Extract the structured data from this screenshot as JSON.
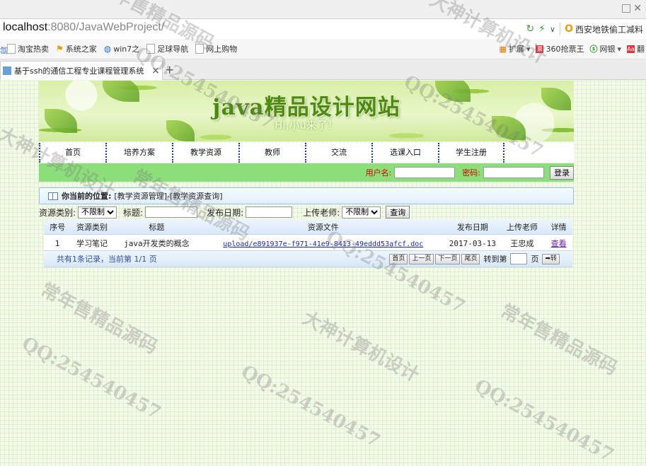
{
  "browser": {
    "url_host": "localhost",
    "url_rest": ":8080/JavaWebProject/",
    "search_hint": "西安地铁偷工减料",
    "bookmarks": [
      "淘宝热卖",
      "系统之家",
      "win7之",
      "足球导航",
      "网上购物"
    ],
    "toolbar_right": [
      "扩展",
      "360抢票王",
      "网银",
      "翻"
    ],
    "tab_title": "基于ssh的通信工程专业课程管理系统"
  },
  "site": {
    "title": "java精品设计网站",
    "subtitle": "Hi,小u来了！",
    "nav": [
      "首页",
      "培养方案",
      "教学资源",
      "教师",
      "交流",
      "选课入口",
      "学生注册"
    ],
    "login": {
      "username_label": "用户名:",
      "password_label": "密码:",
      "button": "登录"
    },
    "position": {
      "label": "你当前的位置:",
      "path": "[教学资源管理]-[教学资源查询]"
    }
  },
  "filters": {
    "type_label": "资源类别:",
    "type_value": "不限制",
    "title_label": "标题:",
    "date_label": "发布日期:",
    "teacher_label": "上传老师:",
    "teacher_value": "不限制",
    "query_button": "查询"
  },
  "table": {
    "headers": [
      "序号",
      "资源类别",
      "标题",
      "资源文件",
      "发布日期",
      "上传老师",
      "详情"
    ],
    "rows": [
      {
        "no": "1",
        "type": "学习笔记",
        "title": "java开发类的概念",
        "file": "upload/e891937e-f971-41e9-8413-49eddd53afcf.doc",
        "date": "2017-03-13",
        "teacher": "王忠成",
        "detail": "查看"
      }
    ]
  },
  "pager": {
    "info": "共有1条记录，当前第 1/1 页",
    "first": "首页",
    "prev": "上一页",
    "next": "下一页",
    "last": "尾页",
    "goto_label": "转到第",
    "page_unit": "页",
    "goto_button": "➡转"
  },
  "watermark": {
    "lines": [
      "常年售精品源码",
      "QQ:254540457",
      "大神计算机设计"
    ]
  }
}
